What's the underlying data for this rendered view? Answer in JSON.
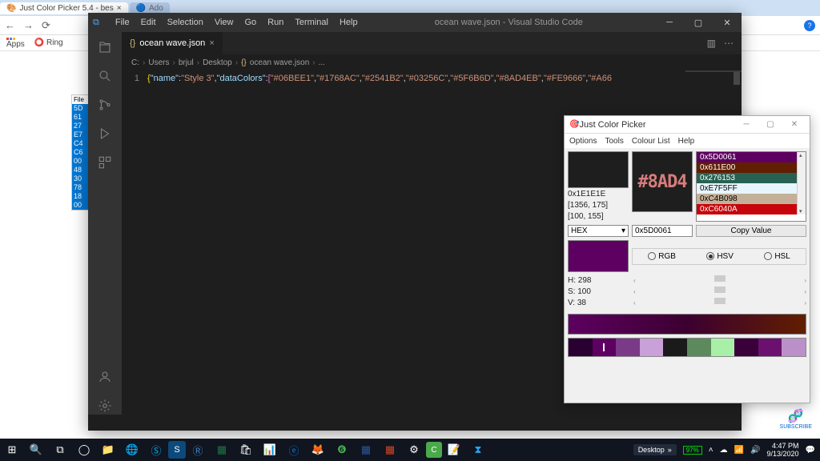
{
  "browser": {
    "tabs": [
      {
        "label": "Just Color Picker 5.4 - bes",
        "active": true
      },
      {
        "label": "Ado",
        "active": false
      }
    ],
    "bookmarks": {
      "apps": "Apps",
      "ring": "Ring"
    },
    "avatar": "?"
  },
  "notepad": {
    "title": "File",
    "rows": [
      "5D",
      "61",
      "27",
      "E7",
      "C4",
      "C6",
      "00",
      "48",
      "30",
      "78",
      "18",
      "00"
    ]
  },
  "vscode": {
    "menu": [
      "File",
      "Edit",
      "Selection",
      "View",
      "Go",
      "Run",
      "Terminal",
      "Help"
    ],
    "title": "ocean wave.json - Visual Studio Code",
    "tab": {
      "name": "ocean wave.json",
      "close": "×"
    },
    "breadcrumb": [
      "C:",
      "Users",
      "brjul",
      "Desktop",
      "ocean wave.json",
      "..."
    ],
    "line_no": "1",
    "code": {
      "k_name": "\"name\"",
      "v_name": "\"Style 3\"",
      "k_dc": "\"dataColors\"",
      "colors": [
        "\"#06BEE1\"",
        "\"#1768AC\"",
        "\"#2541B2\"",
        "\"#03256C\"",
        "\"#5F6B6D\"",
        "\"#8AD4EB\"",
        "\"#FE9666\"",
        "\"#A66"
      ]
    }
  },
  "picker": {
    "title": "Just Color Picker",
    "menu": [
      "Options",
      "Tools",
      "Colour List",
      "Help"
    ],
    "zoom_text": "#8AD4",
    "current_hex": "0x1E1E1E",
    "coords1": "[1356, 175]",
    "coords2": "[100, 155]",
    "list": [
      {
        "label": "0x5D0061",
        "bg": "#5d0061"
      },
      {
        "label": "0x611E00",
        "bg": "#611e00"
      },
      {
        "label": "0x276153",
        "bg": "#276153"
      },
      {
        "label": "0xE7F5FF",
        "bg": "#e7f5ff",
        "fg": "#000"
      },
      {
        "label": "0xC4B098",
        "bg": "#c4b098",
        "fg": "#000"
      },
      {
        "label": "0xC6040A",
        "bg": "#c6040a"
      }
    ],
    "format_label": "HEX",
    "value_input": "0x5D0061",
    "copy_label": "Copy Value",
    "swatch": "#5d0061",
    "radios": {
      "rgb": "RGB",
      "hsv": "HSV",
      "hsl": "HSL",
      "selected": "hsv"
    },
    "hsv": {
      "h": "H: 298",
      "s": "S: 100",
      "v": "V: 38"
    },
    "palette": [
      "#2a0033",
      "#5d0061",
      "#7a3a88",
      "#c9a0d8",
      "#1a1a1a",
      "#5c8a5c",
      "#a8f0a8",
      "#3a003a",
      "#6c1070",
      "#bb90c8"
    ]
  },
  "taskbar": {
    "desktop_label": "Desktop",
    "battery": "97%",
    "time": "4:47 PM",
    "date": "9/13/2020"
  },
  "subscribe": "SUBSCRIBE"
}
